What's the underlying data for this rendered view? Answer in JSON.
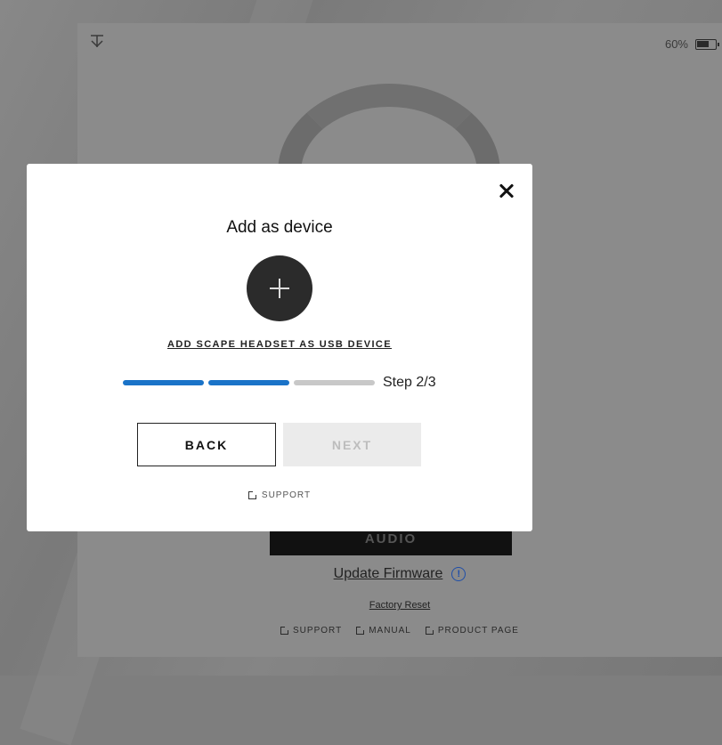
{
  "device_panel": {
    "battery_text": "60%",
    "battery_icon": "battery-icon",
    "top_left_icon": "download-arrow-icon",
    "audio_label": "AUDIO",
    "update_firmware_label": "Update Firmware",
    "info_icon": "info-icon",
    "info_glyph": "!",
    "factory_reset_label": "Factory Reset",
    "links": [
      "SUPPORT",
      "MANUAL",
      "PRODUCT PAGE"
    ]
  },
  "modal": {
    "title": "Add as device",
    "add_icon": "plus-icon",
    "add_usb_label": "ADD SCAPE HEADSET AS USB DEVICE",
    "progress": {
      "current_step": 2,
      "total_steps": 3,
      "label": "Step 2/3",
      "accent": "#1a73c8"
    },
    "back_label": "BACK",
    "next_label": "NEXT",
    "support_label": "SUPPORT",
    "close_icon": "close-icon"
  }
}
